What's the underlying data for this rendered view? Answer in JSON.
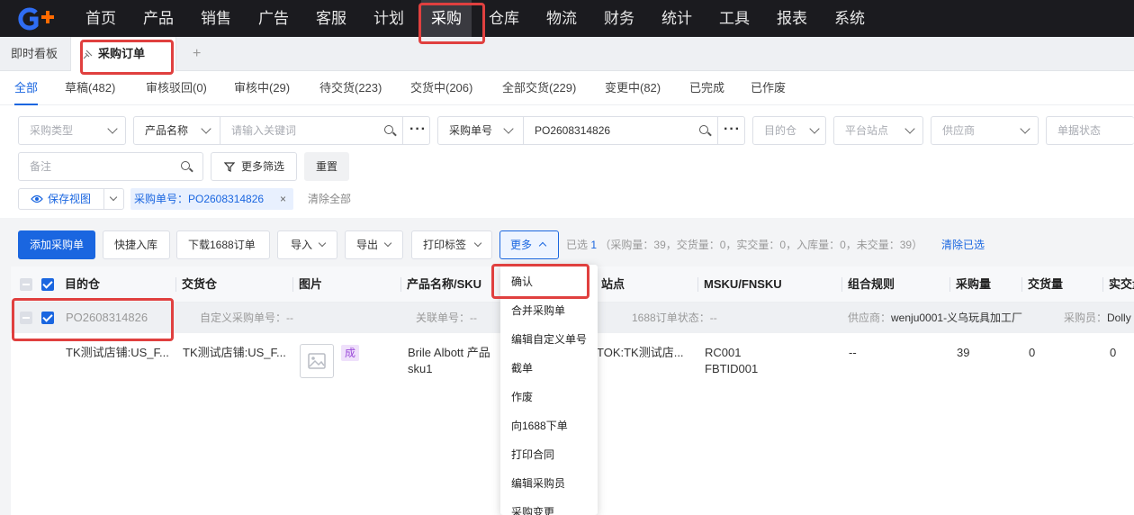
{
  "nav": [
    "首页",
    "产品",
    "销售",
    "广告",
    "客服",
    "计划",
    "采购",
    "仓库",
    "物流",
    "财务",
    "统计",
    "工具",
    "报表",
    "系统"
  ],
  "tabs": {
    "dashboard": "即时看板",
    "purchase_order": "采购订单",
    "add": "+"
  },
  "status_tabs": [
    "全部",
    "草稿(482)",
    "审核驳回(0)",
    "审核中(29)",
    "待交货(223)",
    "交货中(206)",
    "全部交货(229)",
    "变更中(82)",
    "已完成",
    "已作废"
  ],
  "filters": {
    "purchase_type": "采购类型",
    "product_name": "产品名称",
    "keyword_placeholder": "请输入关键词",
    "po_no_label": "采购单号",
    "po_no_value": "PO2608314826",
    "destination": "目的仓",
    "platform_site": "平台站点",
    "supplier": "供应商",
    "doc_status": "单据状态",
    "remark": "备注",
    "more_filters": "更多筛选",
    "reset": "重置",
    "save_view": "保存视图",
    "active_chip": "采购单号：PO2608314826",
    "clear_all": "清除全部"
  },
  "toolbar": {
    "add_po": "添加采购单",
    "quick_inbound": "快捷入库",
    "download_1688": "下载1688订单",
    "import": "导入",
    "export": "导出",
    "print_label": "打印标签",
    "more": "更多",
    "selected_prefix": "已选",
    "selected_count": "1",
    "summary": "（采购量：39，交货量：0，实交量：0，入库量：0，未交量：39）",
    "clear_selected": "清除已选"
  },
  "table": {
    "headers": [
      "目的仓",
      "交货仓",
      "图片",
      "产品名称/SKU",
      "站点",
      "MSKU/FNSKU",
      "组合规则",
      "采购量",
      "交货量",
      "实交量"
    ],
    "group": {
      "po_no": "PO2608314826",
      "custom_no": "自定义采购单号：--",
      "related_no": "关联单号：--",
      "status_1688": "1688订单状态：--",
      "supplier_label": "供应商：",
      "supplier": "wenju0001-义乌玩具加工厂",
      "buyer_label": "采购员：",
      "buyer": "Dolly"
    },
    "row": {
      "destination": "TK测试店铺:US_F...",
      "delivery": "TK测试店铺:US_F...",
      "tag": "成",
      "product_name": "Brile Albott 产品",
      "sku": "sku1",
      "site": "TOK:TK测试店...",
      "msku": "RC001",
      "fnsku": "FBTID001",
      "combo": "--",
      "qty": "39",
      "delivered": "0",
      "actual": "0"
    }
  },
  "more_menu": [
    "确认",
    "合并采购单",
    "编辑自定义单号",
    "截单",
    "作废",
    "向1688下单",
    "打印合同",
    "编辑采购员",
    "采购变更"
  ],
  "colors": {
    "accent": "#1a66e0",
    "highlight": "#e0403f",
    "topbar": "#1b1b1f"
  }
}
